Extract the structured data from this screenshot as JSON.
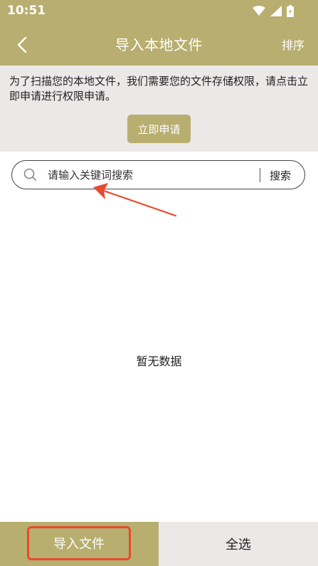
{
  "status_bar": {
    "time": "10:51",
    "icons": [
      "wifi-icon",
      "cell-signal-icon",
      "battery-icon"
    ]
  },
  "nav": {
    "title": "导入本地文件",
    "sort_label": "排序",
    "back_icon": "chevron-left-icon"
  },
  "permission": {
    "message": "为了扫描您的本地文件，我们需要您的文件存储权限，请点击立即申请进行权限申请。",
    "button_label": "立即申请"
  },
  "search": {
    "placeholder": "请输入关键词搜索",
    "button_label": "搜索",
    "icon": "search-icon"
  },
  "content": {
    "empty_text": "暂无数据"
  },
  "bottom_bar": {
    "import_label": "导入文件",
    "select_all_label": "全选"
  },
  "colors": {
    "accent": "#b7ae6f",
    "panel_gray": "#ebe8e8",
    "annotation_red": "#e8492f"
  }
}
